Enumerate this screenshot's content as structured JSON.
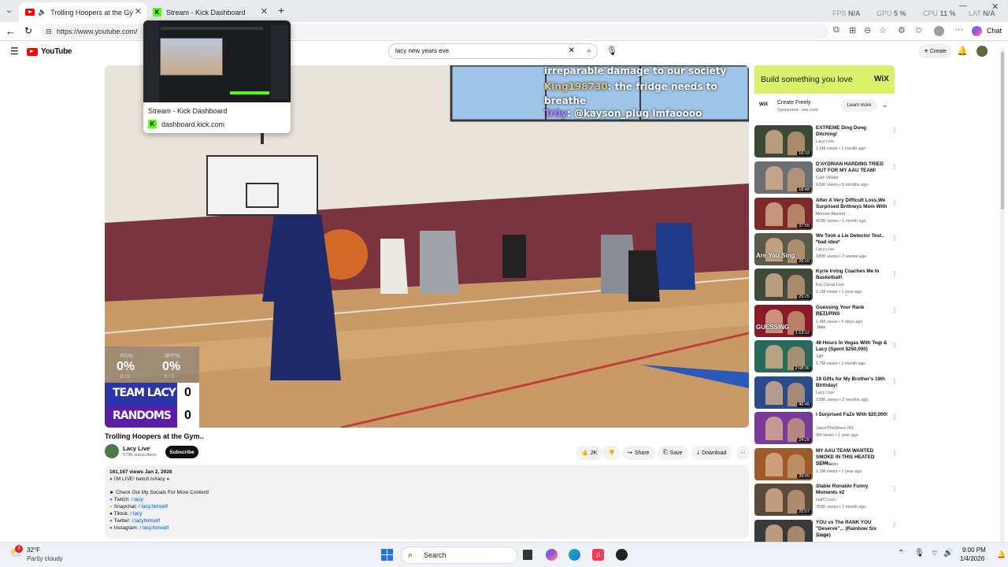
{
  "browser": {
    "tabs": [
      {
        "title": "Trolling Hoopers at the Gym..",
        "favicon": "youtube-icon",
        "active": true
      },
      {
        "title": "Stream - Kick Dashboard",
        "favicon": "kick-icon",
        "active": false
      }
    ],
    "stats": {
      "fps_label": "FPS",
      "fps_value": "N/A",
      "gpu_label": "GPU",
      "gpu_value": "5 %",
      "cpu_label": "CPU",
      "cpu_value": "11 %",
      "lat_label": "LAT",
      "lat_value": "N/A"
    },
    "url": "https://www.youtube.com/",
    "chat_button": "Chat"
  },
  "tab_preview": {
    "title": "Stream - Kick Dashboard",
    "domain": "dashboard.kick.com"
  },
  "youtube": {
    "logo": "YouTube",
    "search_query": "lacy  new years eve",
    "create_label": "Create"
  },
  "video": {
    "chat": [
      {
        "name": "",
        "text": "irreparable damage to our society"
      },
      {
        "name": "King198730",
        "text": ": the fridge needs to breathe"
      },
      {
        "name": "Tr0y",
        "text": ": @kayson_plug lmfaoooo"
      }
    ],
    "scoreboard": {
      "label_left": "FG%",
      "label_right": "3PT%",
      "pct_left": "0%",
      "pct_right": "0%",
      "sub_left": "0 / 0",
      "sub_right": "0 / 0",
      "teams": [
        {
          "name": "TEAM LACY",
          "score": "0"
        },
        {
          "name": "RANDOMS",
          "score": "0"
        }
      ]
    },
    "title": "Trolling Hoopers at the Gym..",
    "channel": "Lacy Live",
    "subscribers": "573K subscribers",
    "subscribe_label": "Subscribe",
    "likes": "2K",
    "share_label": "Share",
    "save_label": "Save",
    "download_label": "Download"
  },
  "description": {
    "stats": "161,167 views  Jan 2, 2026",
    "live": "I'M LIVE! twitch.tv/lacy",
    "heading": "► Check Out My Socials For More Content!",
    "socials": [
      {
        "label": "Twitch:",
        "handle": "/ lacy"
      },
      {
        "label": "Snapchat:",
        "handle": "/ lacy.himself"
      },
      {
        "label": "Tiktok:",
        "handle": "/ lacy"
      },
      {
        "label": "Twitter:",
        "handle": "/ lacyhimself"
      },
      {
        "label": "Instagram:",
        "handle": "/ lacy.himself"
      }
    ]
  },
  "ad": {
    "headline": "Build something you love",
    "brand": "WiX",
    "cta_title": "Create Freely",
    "sponsored": "Sponsored · wix.com",
    "learn_more": "Learn more"
  },
  "recommendations": [
    {
      "title": "EXTREME Ding Dong Ditching!",
      "channel": "Lacy Live",
      "meta": "1.6M views • 1 month ago",
      "duration": "16:18",
      "color": "#3a4a35"
    },
    {
      "title": "D'AYDRIAN HARDING TRIED OUT FOR MY AAU TEAM!",
      "channel": "Cam Wilder",
      "meta": "639K views • 5 months ago",
      "duration": "18:48",
      "color": "#6b6e73"
    },
    {
      "title": "After A Very Difficult Loss,We Surprised Brittneys Mom With ...",
      "channel": "Roman Atwood",
      "meta": "423K views • 1 month ago",
      "duration": "37:55",
      "color": "#7a2a2a"
    },
    {
      "title": "We Took a Lie Detector Test.. *bad idea*",
      "channel": "Lacy Live",
      "meta": "189K views • 2 weeks ago",
      "duration": "26:10",
      "color": "#5a5a4a",
      "overlay": "Are You Sing"
    },
    {
      "title": "Kyrie Irving Coaches Me In Basketball!",
      "channel": "Kai Cenat Live",
      "meta": "2.1M views • 1 year ago",
      "duration": "25:25",
      "color": "#3f4a3a"
    },
    {
      "title": "Guessing Your Rank RETURNS",
      "channel": "Jynxzi",
      "meta": "1.4M views • 6 days ago",
      "duration": "1:13:12",
      "color": "#8a1a2a",
      "badge": "New",
      "overlay": "GUESSING"
    },
    {
      "title": "48 Hours In Vegas With Togi & Lacy (Spent $250,000)",
      "channel": "Sjiff",
      "meta": "1.7M views • 1 month ago",
      "duration": "2:08:30",
      "color": "#2a6a5a"
    },
    {
      "title": "19 Gifts for My Brother's 19th Birthday!",
      "channel": "Lacy Live",
      "meta": "238K views • 2 months ago",
      "duration": "46:45",
      "color": "#2a4a8a"
    },
    {
      "title": "I Surprised FaZe With $20,000!",
      "channel": "JasonTheWeen IRL",
      "meta": "1M views • 1 year ago",
      "duration": "24:28",
      "color": "#7a3a9a"
    },
    {
      "title": "MY AAU TEAM WANTED SMOKE IN THIS HEATED SEMI...",
      "channel": "Cam Wilder",
      "meta": "2.1M views • 1 year ago",
      "duration": "39:05",
      "color": "#a05a2a"
    },
    {
      "title": "Stable Ronaldo Funny Moments #2",
      "channel": "Half Court",
      "meta": "358K views • 1 month ago",
      "duration": "20:07",
      "color": "#5a4a3a"
    },
    {
      "title": "YOU vs The RANK YOU \"Deserve\"... (Rainbow Six Siege)",
      "channel": "Jynxzi",
      "meta": "",
      "duration": "",
      "color": "#3a3a3a"
    }
  ],
  "taskbar": {
    "weather_temp": "32°F",
    "weather_desc": "Partly cloudy",
    "weather_badge": "3",
    "search_label": "Search",
    "time": "9:00 PM",
    "date": "1/4/2026"
  }
}
